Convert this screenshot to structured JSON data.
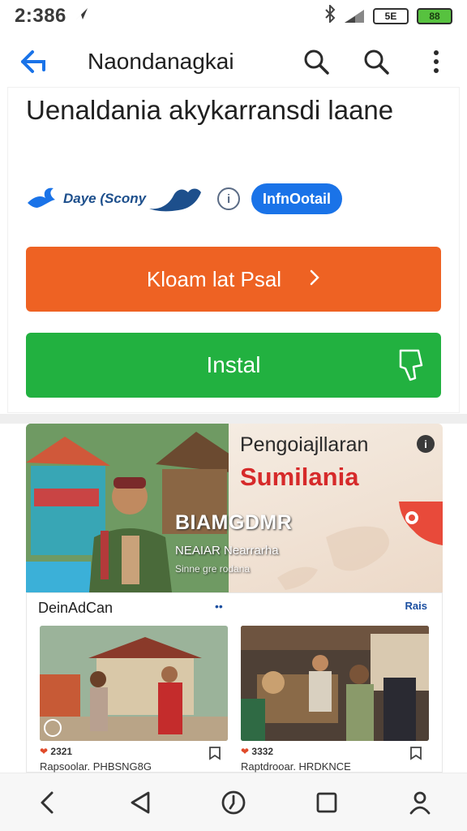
{
  "status_bar": {
    "time": "2:386",
    "battery_left": "5E",
    "battery_right": "88"
  },
  "app_bar": {
    "title": "Naondanagkai",
    "icons": [
      "back-arrow-icon",
      "search-icon",
      "search-icon",
      "more-vert-icon"
    ]
  },
  "listing": {
    "headline": "Uenaldania akykarransdi laane",
    "developer": "Daye (Scony",
    "info_pill": "InfnOotail",
    "primary_button": "Kloam lat Psal",
    "install_button": "Instal",
    "accent_colors": {
      "orange": "#ee6223",
      "green": "#22b140",
      "blue": "#1a73e8"
    }
  },
  "hero": {
    "title": "Pengoiajllaran",
    "subtitle": "Sumilania",
    "watermark": "BIAMGDMR",
    "caption": "NEAIAR Nearrarha",
    "caption2": "Sinne gre rodana"
  },
  "section": {
    "title": "DeinAdCan",
    "dots": "••",
    "more": "Rais",
    "cards": [
      {
        "meta": "2321",
        "subtitle": "Rapsoolar. PHBSNG8G"
      },
      {
        "meta": "3332",
        "subtitle": "Raptdrooar. HRDKNCE"
      }
    ]
  },
  "nav_bar": {
    "icons": [
      "chevron-left-icon",
      "triangle-back-icon",
      "compass-icon",
      "square-recents-icon",
      "person-icon"
    ]
  }
}
